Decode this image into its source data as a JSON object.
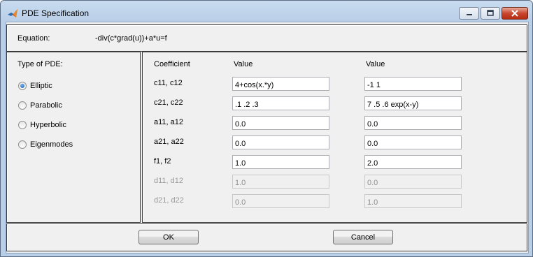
{
  "window": {
    "title": "PDE Specification"
  },
  "equation": {
    "label": "Equation:",
    "value": "-div(c*grad(u))+a*u=f"
  },
  "pde_type": {
    "label": "Type of PDE:",
    "options": [
      {
        "label": "Elliptic",
        "checked": true
      },
      {
        "label": "Parabolic",
        "checked": false
      },
      {
        "label": "Hyperbolic",
        "checked": false
      },
      {
        "label": "Eigenmodes",
        "checked": false
      }
    ]
  },
  "coefficients": {
    "header_coefficient": "Coefficient",
    "header_value1": "Value",
    "header_value2": "Value",
    "rows": [
      {
        "name": "c11, c12",
        "v1": "4+cos(x.*y)",
        "v2": "-1 1",
        "enabled": true
      },
      {
        "name": "c21, c22",
        "v1": ".1 .2 .3",
        "v2": "7 .5 .6 exp(x-y)",
        "enabled": true
      },
      {
        "name": "a11, a12",
        "v1": "0.0",
        "v2": "0.0",
        "enabled": true
      },
      {
        "name": "a21, a22",
        "v1": "0.0",
        "v2": "0.0",
        "enabled": true
      },
      {
        "name": "f1, f2",
        "v1": "1.0",
        "v2": "2.0",
        "enabled": true
      },
      {
        "name": "d11, d12",
        "v1": "1.0",
        "v2": "0.0",
        "enabled": false
      },
      {
        "name": "d21, d22",
        "v1": "0.0",
        "v2": "1.0",
        "enabled": false
      }
    ]
  },
  "buttons": {
    "ok": "OK",
    "cancel": "Cancel"
  }
}
